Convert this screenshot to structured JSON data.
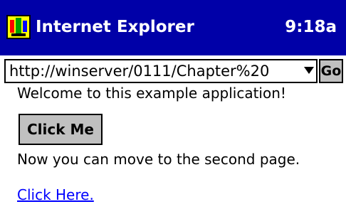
{
  "titlebar": {
    "app_icon": "internet-explorer-icon",
    "title": "Internet Explorer",
    "time": "9:18a",
    "background": "#0000a8"
  },
  "addressbar": {
    "url": "http://winserver/0111/Chapter%20",
    "dropdown_icon": "chevron-down-icon",
    "go_label": "Go"
  },
  "content": {
    "welcome_text": "Welcome to this example application!",
    "button_label": "Click Me",
    "next_text": "Now you can move to the second page.",
    "link_text": "Click Here.",
    "link_color": "#0000ff"
  }
}
